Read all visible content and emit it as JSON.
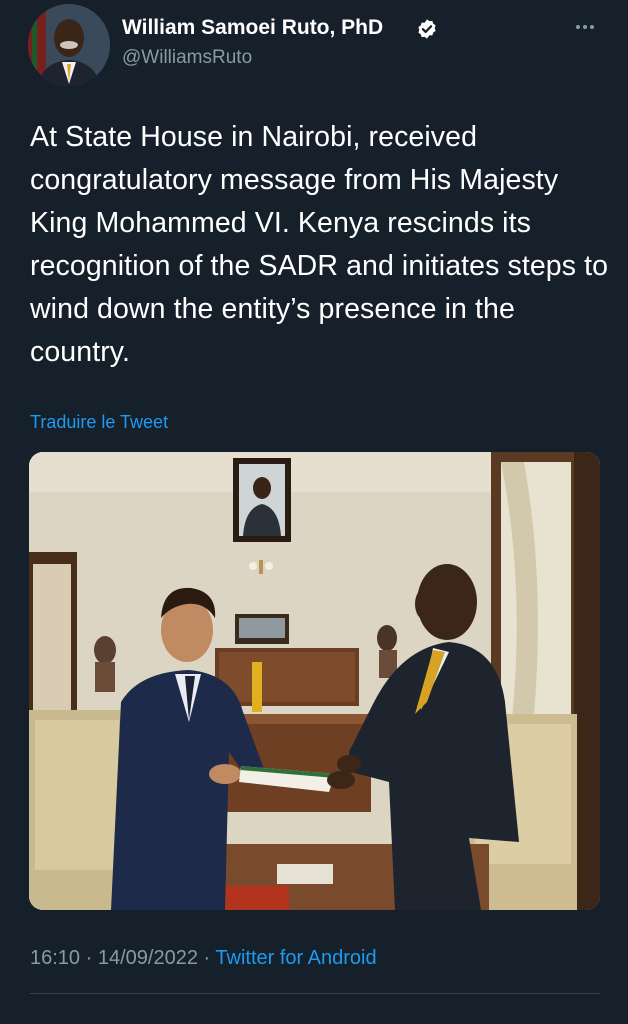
{
  "author": {
    "name": "William Samoei Ruto, PhD",
    "handle": "@WilliamsRuto",
    "verified": true,
    "avatar_icon": "profile-photo"
  },
  "tweet": {
    "text": "At State House in Nairobi, received congratulatory message from His Majesty King Mohammed VI. Kenya rescinds its recognition of the SADR and initiates steps to wind down the entity’s presence in the country.",
    "translate_label": "Traduire le Tweet",
    "time": "16:10",
    "date": "14/09/2022",
    "separator": "·",
    "source": "Twitter for Android"
  },
  "menu": {
    "more_icon": "more-horizontal-icon"
  },
  "colors": {
    "background": "#15202b",
    "link": "#1d9bf0",
    "secondary_text": "#8b98a5",
    "divider": "#38444d"
  }
}
